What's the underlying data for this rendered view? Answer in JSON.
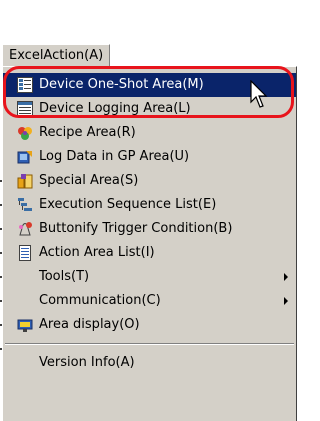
{
  "menu_title": "ExcelAction(A)",
  "items": [
    {
      "label": "Device One-Shot Area(M)",
      "icon": "device-one-shot-icon"
    },
    {
      "label": "Device Logging Area(L)",
      "icon": "device-logging-icon"
    },
    {
      "label": "Recipe Area(R)",
      "icon": "recipe-icon"
    },
    {
      "label": "Log Data in GP Area(U)",
      "icon": "log-data-icon"
    },
    {
      "label": "Special Area(S)",
      "icon": "special-area-icon"
    },
    {
      "label": "Execution Sequence List(E)",
      "icon": "execution-sequence-icon"
    },
    {
      "label": "Buttonify Trigger Condition(B)",
      "icon": "buttonify-trigger-icon"
    },
    {
      "label": "Action Area List(I)",
      "icon": "action-area-list-icon"
    },
    {
      "label": "Tools(T)",
      "icon": null
    },
    {
      "label": "Communication(C)",
      "icon": null
    },
    {
      "label": "Area display(O)",
      "icon": "area-display-icon"
    },
    {
      "label": "Version Info(A)",
      "icon": null
    }
  ],
  "colors": {
    "menu_bg": "#d4d0c8",
    "highlight_bg": "#0a246a",
    "highlight_text": "#ffffff",
    "callout": "#e8141c"
  }
}
